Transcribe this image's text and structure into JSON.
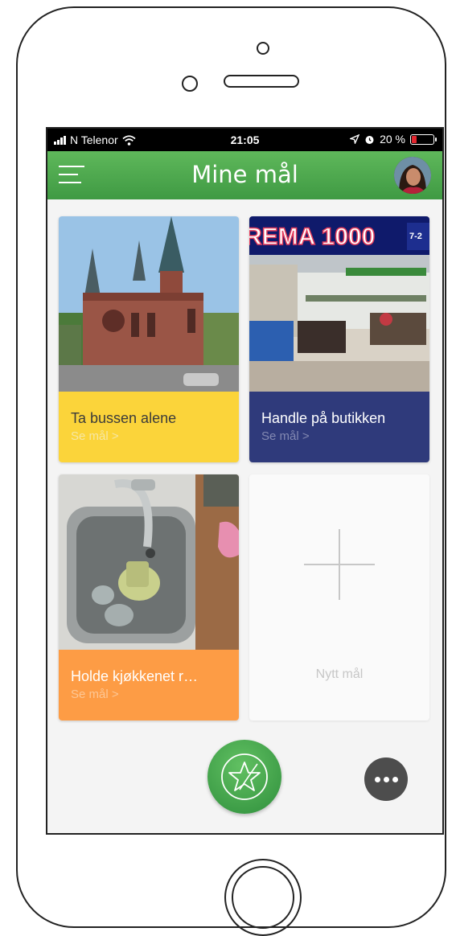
{
  "status_bar": {
    "carrier": "N Telenor",
    "time": "21:05",
    "battery": "20 %",
    "battery_level": 0.2
  },
  "header": {
    "title": "Mine mål",
    "menu_icon": "hamburger-menu-icon",
    "avatar": "user-avatar"
  },
  "goals": [
    {
      "title": "Ta bussen alene",
      "link": "Se mål >",
      "color": "#fbd43a",
      "image": "church-photo"
    },
    {
      "title": "Handle på butikken",
      "link": "Se mål >",
      "color": "#2f3a7b",
      "image": "rema-1000-store-photo"
    },
    {
      "title": "Holde kjøkkenet r…",
      "link": "Se mål >",
      "color": "#fd9c45",
      "image": "kitchen-sink-photo"
    }
  ],
  "new_goal": {
    "label": "Nytt mål",
    "icon": "plus-icon"
  },
  "fab": {
    "icon": "star-icon",
    "color": "#3f9a43"
  },
  "more": {
    "icon": "more-dots-icon"
  },
  "photo_text": {
    "store_sign": "REMA 1000",
    "store_hours": "7-2"
  }
}
